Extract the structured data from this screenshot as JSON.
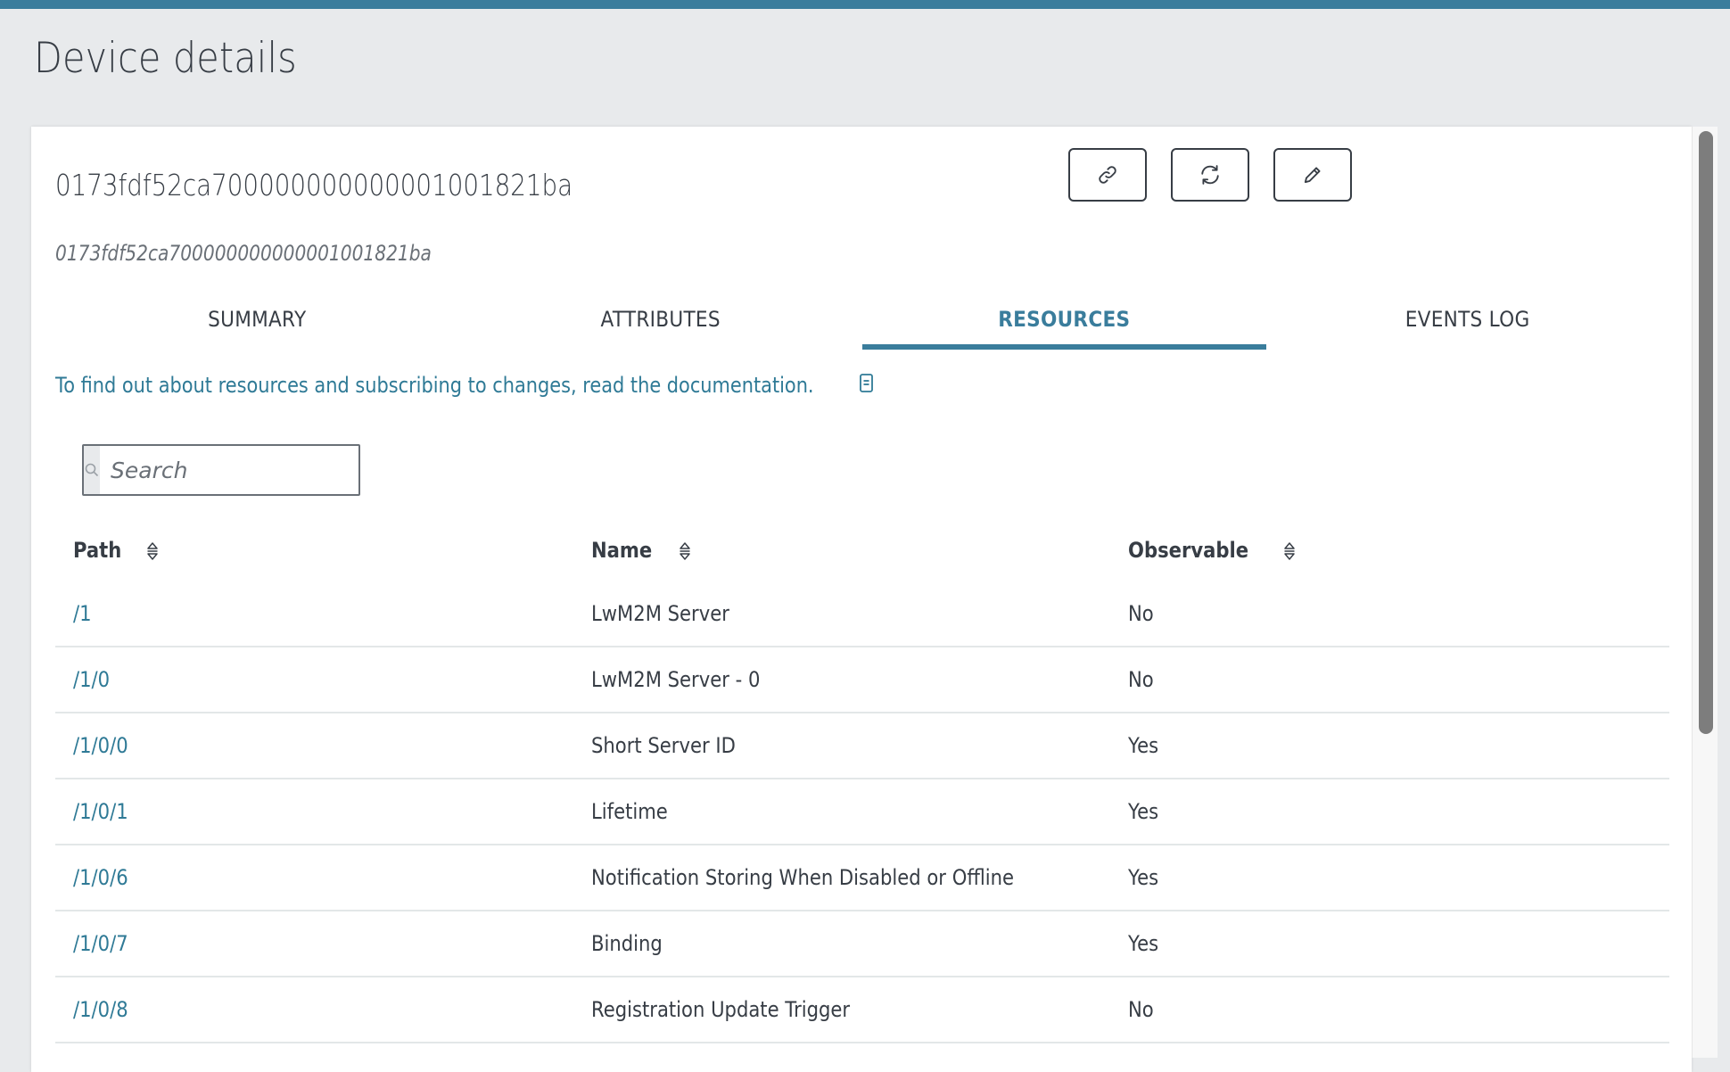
{
  "page": {
    "title": "Device details"
  },
  "device": {
    "id": "0173fdf52ca700000000000001001821ba",
    "subtitle": "0173fdf52ca700000000000001001821ba"
  },
  "actions": [
    {
      "name": "link",
      "icon": "link-icon"
    },
    {
      "name": "refresh",
      "icon": "refresh-icon"
    },
    {
      "name": "edit",
      "icon": "pencil-icon"
    }
  ],
  "tabs": [
    {
      "label": "SUMMARY",
      "active": false
    },
    {
      "label": "ATTRIBUTES",
      "active": false
    },
    {
      "label": "RESOURCES",
      "active": true
    },
    {
      "label": "EVENTS LOG",
      "active": false
    }
  ],
  "doc_hint": {
    "text": "To find out about resources and subscribing to changes, read the documentation.",
    "icon": "document-icon"
  },
  "search": {
    "placeholder": "Search",
    "value": ""
  },
  "table": {
    "columns": [
      {
        "label": "Path",
        "sortable": true
      },
      {
        "label": "Name",
        "sortable": true
      },
      {
        "label": "Observable",
        "sortable": true
      }
    ],
    "rows": [
      {
        "path": "/1",
        "name": "LwM2M Server",
        "observable": "No"
      },
      {
        "path": "/1/0",
        "name": "LwM2M Server - 0",
        "observable": "No"
      },
      {
        "path": "/1/0/0",
        "name": "Short Server ID",
        "observable": "Yes"
      },
      {
        "path": "/1/0/1",
        "name": "Lifetime",
        "observable": "Yes"
      },
      {
        "path": "/1/0/6",
        "name": "Notification Storing When Disabled or Offline",
        "observable": "Yes"
      },
      {
        "path": "/1/0/7",
        "name": "Binding",
        "observable": "Yes"
      },
      {
        "path": "/1/0/8",
        "name": "Registration Update Trigger",
        "observable": "No"
      }
    ]
  },
  "colors": {
    "accent": "#3a7d9c",
    "link": "#2f7a96",
    "text": "#373d45",
    "background": "#e8eaec"
  }
}
